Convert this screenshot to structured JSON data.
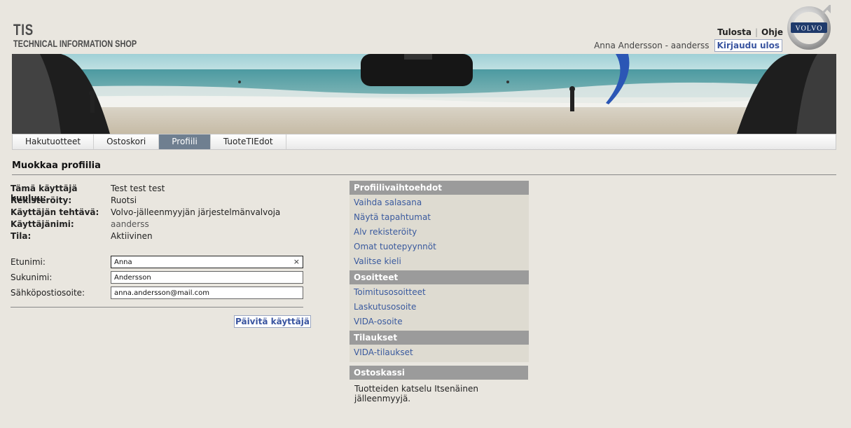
{
  "brand": {
    "name": "TIS",
    "subtitle": "TECHNICAL INFORMATION SHOP"
  },
  "top_links": {
    "print": "Tulosta",
    "help": "Ohje"
  },
  "user": {
    "display": "Anna Andersson - aanderss",
    "logout": "Kirjaudu ulos"
  },
  "tabs": [
    {
      "label": "Hakutuotteet"
    },
    {
      "label": "Ostoskori"
    },
    {
      "label": "Profiili"
    },
    {
      "label": "TuoteTIEdot"
    }
  ],
  "page_title": "Muokkaa profiilia",
  "info": {
    "belongs_label": "Tämä käyttäjä kuuluu:",
    "belongs_value": "Test test test",
    "registered_label": "Rekisteröity:",
    "registered_value": "Ruotsi",
    "role_label": "Käyttäjän tehtävä:",
    "role_value": "Volvo-jälleenmyyjän järjestelmänvalvoja",
    "username_label": "Käyttäjänimi:",
    "username_value": "aanderss",
    "status_label": "Tila:",
    "status_value": "Aktiivinen"
  },
  "form": {
    "first_label": "Etunimi:",
    "first_value": "Anna",
    "last_label": "Sukunimi:",
    "last_value": "Andersson",
    "email_label": "Sähköpostiosoite:",
    "email_value": "anna.andersson@mail.com",
    "submit": "Päivitä käyttäjä"
  },
  "side": {
    "profile_head": "Profiilivaihtoehdot",
    "profile_links": [
      "Vaihda salasana",
      "Näytä tapahtumat",
      "Alv rekisteröity",
      "Omat tuotepyynnöt",
      "Valitse kieli"
    ],
    "address_head": "Osoitteet",
    "address_links": [
      "Toimitusosoitteet",
      "Laskutusosoite",
      "VIDA-osoite"
    ],
    "orders_head": "Tilaukset",
    "orders_links": [
      "VIDA-tilaukset"
    ]
  },
  "cart": {
    "head": "Ostoskassi",
    "text": "Tuotteiden katselu Itsenäinen jälleenmyyjä."
  },
  "colors": {
    "active_tab": "#6f7f90",
    "panel_head": "#9b9b9b",
    "link": "#3a5a9e",
    "background": "#e9e6df"
  }
}
